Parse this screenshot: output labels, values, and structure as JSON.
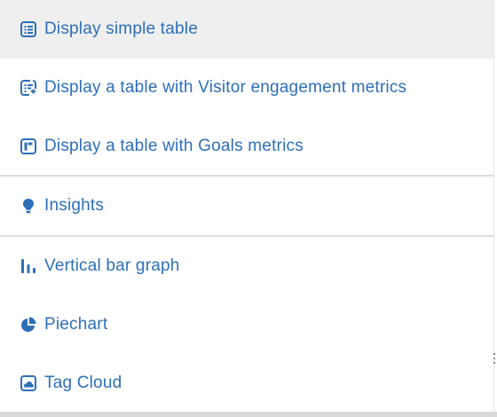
{
  "menu": {
    "items": [
      {
        "label": "Display simple table",
        "icon": "list-table-icon",
        "active": true
      },
      {
        "label": "Display a table with Visitor engagement metrics",
        "icon": "table-edit-icon"
      },
      {
        "label": "Display a table with Goals metrics",
        "icon": "goals-table-icon"
      },
      {
        "label": "Insights",
        "icon": "lightbulb-icon"
      },
      {
        "label": "Vertical bar graph",
        "icon": "bar-chart-icon"
      },
      {
        "label": "Piechart",
        "icon": "pie-chart-icon"
      },
      {
        "label": "Tag Cloud",
        "icon": "tag-cloud-icon"
      }
    ]
  },
  "colors": {
    "link": "#2d6fb8",
    "active_background": "#efefef",
    "divider": "#dcdcdc"
  }
}
